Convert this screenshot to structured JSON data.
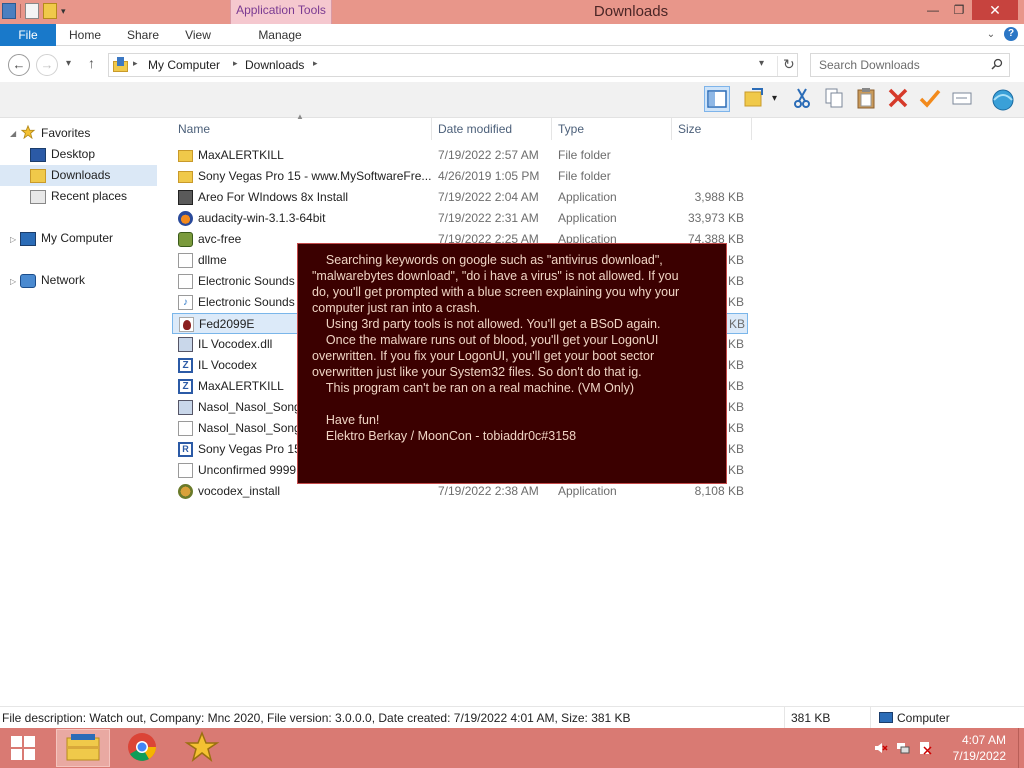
{
  "window": {
    "title": "Downloads",
    "contextual_tab_group": "Application Tools",
    "controls": {
      "minimize": "—",
      "maximize": "❐",
      "close": "✕"
    }
  },
  "ribbon": {
    "tabs": [
      "File",
      "Home",
      "Share",
      "View",
      "Manage"
    ]
  },
  "address_bar": {
    "crumbs": [
      "My Computer",
      "Downloads"
    ],
    "search_placeholder": "Search Downloads"
  },
  "navigation": {
    "favorites_label": "Favorites",
    "favorites": [
      "Desktop",
      "Downloads",
      "Recent places"
    ],
    "selected": "Downloads",
    "my_computer": "My Computer",
    "network": "Network"
  },
  "columns": {
    "name": "Name",
    "date": "Date modified",
    "type": "Type",
    "size": "Size"
  },
  "files": [
    {
      "name": "MaxALERTKILL",
      "date": "7/19/2022 2:57 AM",
      "type": "File folder",
      "size": "",
      "icon": "folder-icon"
    },
    {
      "name": "Sony Vegas Pro 15 - www.MySoftwareFre...",
      "date": "4/26/2019 1:05 PM",
      "type": "File folder",
      "size": "",
      "icon": "folder-icon"
    },
    {
      "name": "Areo For WIndows 8x Install",
      "date": "7/19/2022 2:04 AM",
      "type": "Application",
      "size": "3,988 KB",
      "icon": "areo-app-icon"
    },
    {
      "name": "audacity-win-3.1.3-64bit",
      "date": "7/19/2022 2:31 AM",
      "type": "Application",
      "size": "33,973 KB",
      "icon": "audacity-icon"
    },
    {
      "name": "avc-free",
      "date": "7/19/2022 2:25 AM",
      "type": "Application",
      "size": "74,388 KB",
      "icon": "avc-icon"
    },
    {
      "name": "dllme",
      "date": "",
      "type": "",
      "size": "KB",
      "icon": "document-icon"
    },
    {
      "name": "Electronic Sounds F",
      "date": "",
      "type": "",
      "size": "KB",
      "icon": "document-icon"
    },
    {
      "name": "Electronic Sounds F",
      "date": "",
      "type": "",
      "size": "KB",
      "icon": "music-file-icon"
    },
    {
      "name": "Fed2099E",
      "date": "",
      "type": "",
      "size": "KB",
      "icon": "fed-app-icon"
    },
    {
      "name": "IL Vocodex.dll",
      "date": "",
      "type": "",
      "size": "KB",
      "icon": "dll-file-icon"
    },
    {
      "name": "IL Vocodex",
      "date": "",
      "type": "",
      "size": "KB",
      "icon": "z-app-icon"
    },
    {
      "name": "MaxALERTKILL",
      "date": "",
      "type": "",
      "size": "KB",
      "icon": "z-app-icon"
    },
    {
      "name": "Nasol_Nasol_Song_",
      "date": "",
      "type": "",
      "size": "KB",
      "icon": "image-file-icon"
    },
    {
      "name": "Nasol_Nasol_Song_",
      "date": "",
      "type": "",
      "size": "KB",
      "icon": "document-icon"
    },
    {
      "name": "Sony Vegas Pro 15",
      "date": "",
      "type": "",
      "size": "KB",
      "icon": "r-app-icon"
    },
    {
      "name": "Unconfirmed 9999",
      "date": "",
      "type": "",
      "size": "KB",
      "icon": "document-icon"
    },
    {
      "name": "vocodex_install",
      "date": "7/19/2022 2:38 AM",
      "type": "Application",
      "size": "8,108 KB",
      "icon": "vocodex-install-icon"
    }
  ],
  "selected_file": "Fed2099E",
  "message": {
    "lines": [
      "    Searching keywords on google such as \"antivirus download\",\n\"malwarebytes download\", \"do i have a virus\" is not allowed. If you\ndo, you'll get prompted with a blue screen explaining you why your\ncomputer just ran into a crash.",
      "    Using 3rd party tools is not allowed. You'll get a BSoD again.",
      "    Once the malware runs out of blood, you'll get your LogonUI\noverwritten. If you fix your LogonUI, you'll get your boot sector\noverwritten just like your System32 files. So don't do that ig.",
      "    This program can't be ran on a real machine. (VM Only)",
      "",
      "    Have fun!",
      "    Elektro Berkay / MoonCon - tobiaddr0c#3158"
    ]
  },
  "status": {
    "description": "File description: Watch out, Company: Mnc 2020, File version: 3.0.0.0, Date created: 7/19/2022 4:01 AM, Size: 381 KB",
    "size": "381 KB",
    "location": "Computer"
  },
  "taskbar": {
    "time": "4:07 AM",
    "date": "7/19/2022"
  },
  "colors": {
    "titlebar": "#e8968a",
    "taskbar": "#d97a73",
    "file_tab": "#1979ca",
    "message_bg": "#3b0000",
    "message_text": "#f0d4c4"
  }
}
